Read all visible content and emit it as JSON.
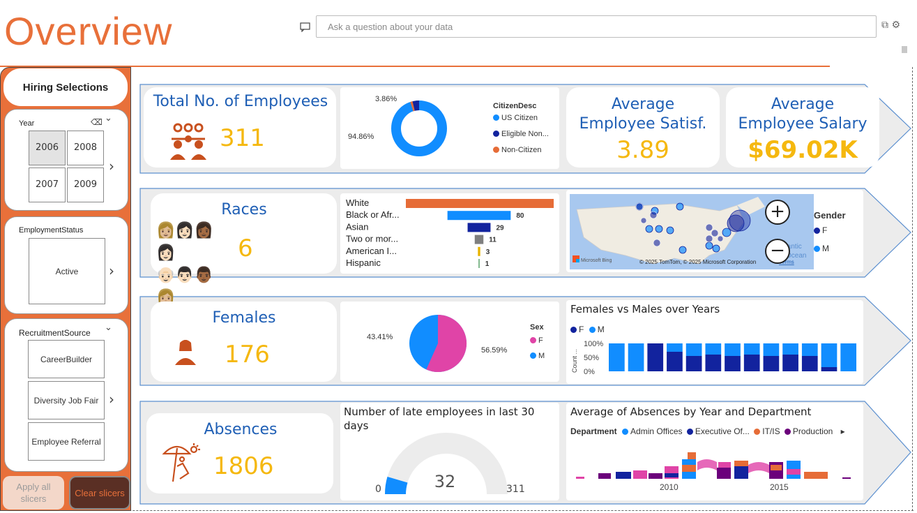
{
  "header": {
    "title": "Overview",
    "qa_placeholder": "Ask a question about your data"
  },
  "colors": {
    "accent": "#e8703a",
    "kpi_title": "#1f5fb5",
    "kpi_value": "#f5b80f",
    "blue": "#118dff",
    "navy": "#12239e",
    "orange": "#e66c37",
    "pink": "#e044a7"
  },
  "slicers": {
    "tab_label": "Hiring Selections",
    "year": {
      "label": "Year",
      "options": [
        "2006",
        "2008",
        "2007",
        "2009"
      ],
      "selected": "2006"
    },
    "employment_status": {
      "label": "EmploymentStatus",
      "options": [
        "Active"
      ]
    },
    "recruitment_source": {
      "label": "RecruitmentSource",
      "options": [
        "CareerBuilder",
        "Diversity Job Fair",
        "Employee Referral"
      ]
    },
    "apply_label": "Apply all slicers",
    "clear_label": "Clear slicers"
  },
  "row1": {
    "total_employees": {
      "title": "Total No. of Employees",
      "value": "311"
    },
    "citizen": {
      "legend_title": "CitizenDesc",
      "labels": {
        "big": "94.86%",
        "small": "3.86%"
      },
      "legend": [
        "US Citizen",
        "Eligible Non...",
        "Non-Citizen"
      ]
    },
    "satisfaction": {
      "title_line1": "Average",
      "title_line2": "Employee Satisf.",
      "value": "3.89"
    },
    "salary": {
      "title_line1": "Average",
      "title_line2": "Employee Salary",
      "value": "$69.02K"
    }
  },
  "row2": {
    "races": {
      "title": "Races",
      "value": "6"
    },
    "race_bars": {
      "labels": [
        "White",
        "Black or Afr...",
        "Asian",
        "Two or mor...",
        "American I...",
        "Hispanic"
      ],
      "value_labels": [
        "",
        "80",
        "29",
        "11",
        "3",
        "1"
      ]
    },
    "map": {
      "legend_title": "Gender",
      "legend": [
        "F",
        "M"
      ],
      "credit": "© 2025 TomTom, © 2025 Microsoft Corporation",
      "terms": "Terms",
      "bing": "Microsoft Bing",
      "ocean_1": "Atlantic",
      "ocean_2": "Ocean"
    }
  },
  "row3": {
    "females": {
      "title": "Females",
      "value": "176"
    },
    "sex_pie": {
      "legend_title": "Sex",
      "legend": [
        "F",
        "M"
      ],
      "labels": {
        "left": "43.41%",
        "right": "56.59%"
      }
    },
    "years_chart": {
      "title": "Females vs Males over Years",
      "legend": [
        "F",
        "M"
      ],
      "y_ticks": [
        "100%",
        "50%",
        "0%"
      ],
      "y_label": "Count ..."
    }
  },
  "row4": {
    "absences": {
      "title": "Absences",
      "value": "1806"
    },
    "gauge": {
      "title": "Number of late employees in last 30 days",
      "value": "32",
      "min": "0",
      "max": "311"
    },
    "abs_chart": {
      "title": "Average of Absences by Year and Department",
      "legend_title": "Department",
      "legend": [
        "Admin Offices",
        "Executive Of...",
        "IT/IS",
        "Production"
      ],
      "x_ticks": [
        "2010",
        "2015"
      ]
    }
  },
  "chart_data": [
    {
      "type": "pie",
      "title": "",
      "categories": [
        "US Citizen",
        "Eligible Non...",
        "Non-Citizen"
      ],
      "values": [
        94.86,
        3.86,
        1.28
      ]
    },
    {
      "type": "bar",
      "title": "",
      "categories": [
        "White",
        "Black or Afr...",
        "Asian",
        "Two or mor...",
        "American I...",
        "Hispanic"
      ],
      "values": [
        187,
        80,
        29,
        11,
        3,
        1
      ]
    },
    {
      "type": "pie",
      "title": "",
      "categories": [
        "F",
        "M"
      ],
      "values": [
        56.59,
        43.41
      ]
    },
    {
      "type": "bar",
      "title": "Females vs Males over Years",
      "series": [
        {
          "name": "F",
          "values": [
            0,
            0,
            100,
            70,
            55,
            60,
            55,
            60,
            55,
            60,
            55,
            15,
            0
          ]
        },
        {
          "name": "M",
          "values": [
            100,
            100,
            0,
            30,
            45,
            40,
            45,
            40,
            45,
            40,
            45,
            85,
            100
          ]
        }
      ],
      "ylim": [
        0,
        100
      ]
    }
  ]
}
